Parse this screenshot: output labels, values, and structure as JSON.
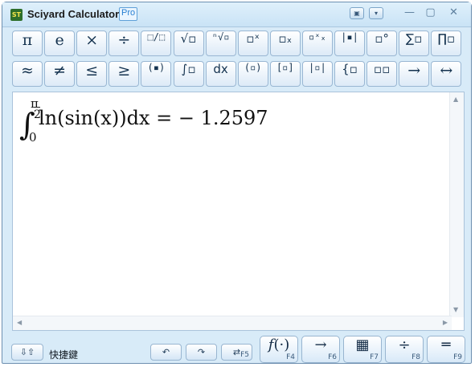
{
  "window": {
    "title": "Sciyard Calculator",
    "badge": "Pro",
    "minimize_icon": "minimize-icon",
    "maximize_icon": "maximize-icon",
    "close_icon": "close-icon"
  },
  "toolbar_row1": [
    {
      "name": "pi-button",
      "label": "π"
    },
    {
      "name": "e-button",
      "label": "e"
    },
    {
      "name": "multiply-button",
      "label": "×"
    },
    {
      "name": "divide-button",
      "label": "÷"
    },
    {
      "name": "fraction-button",
      "label": "⬚/⬚"
    },
    {
      "name": "sqrt-button",
      "label": "√▫"
    },
    {
      "name": "root-button",
      "label": "ⁿ√▫"
    },
    {
      "name": "power-button",
      "label": "▫ˣ"
    },
    {
      "name": "subscript-button",
      "label": "▫ₓ"
    },
    {
      "name": "subscript-power-button",
      "label": "▫ˣₓ"
    },
    {
      "name": "absolute-button",
      "label": "|▪|"
    },
    {
      "name": "degree-button",
      "label": "▫°"
    },
    {
      "name": "sum-button",
      "label": "∑▫"
    },
    {
      "name": "product-button",
      "label": "∏▫"
    }
  ],
  "toolbar_row2": [
    {
      "name": "approx-button",
      "label": "≈"
    },
    {
      "name": "not-equal-button",
      "label": "≠"
    },
    {
      "name": "less-equal-button",
      "label": "≤"
    },
    {
      "name": "greater-equal-button",
      "label": "≥"
    },
    {
      "name": "paren-button",
      "label": "(▪)"
    },
    {
      "name": "integral-button",
      "label": "∫▫"
    },
    {
      "name": "dx-button",
      "label": "dx"
    },
    {
      "name": "paren-square-button",
      "label": "(▫)"
    },
    {
      "name": "bracket-button",
      "label": "[▫]"
    },
    {
      "name": "abs-square-button",
      "label": "|▫|"
    },
    {
      "name": "brace-button",
      "label": "{▫"
    },
    {
      "name": "matrix-button",
      "label": "▫▫"
    },
    {
      "name": "arrow-right-button",
      "label": "→"
    },
    {
      "name": "arrow-both-button",
      "label": "↔"
    }
  ],
  "formula": {
    "integral_upper_num": "π",
    "integral_upper_den": "2",
    "integral_lower": "0",
    "expression": "ln(sin(x))dx = − 1.2597"
  },
  "bottom": {
    "shortcut_label": "快捷鍵",
    "undo_icon": "undo-icon",
    "redo_icon": "redo-icon",
    "swap_label": "F5",
    "func_label": "F4",
    "arrow_label": "F6",
    "grid_label": "F7",
    "frac_label": "F8",
    "equal_label": "F9"
  }
}
